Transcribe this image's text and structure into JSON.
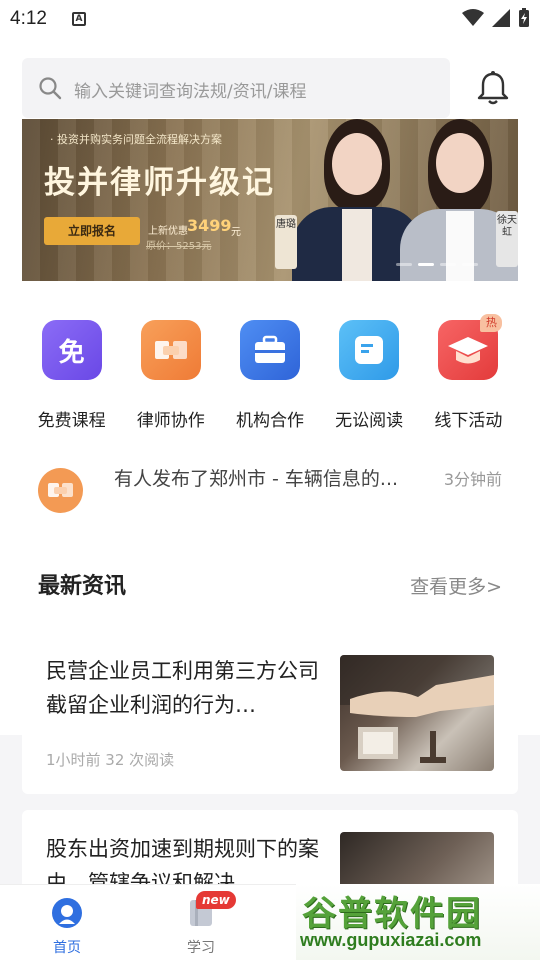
{
  "status_bar": {
    "time": "4:12",
    "sim_label": "A"
  },
  "search": {
    "placeholder": "输入关键词查询法规/资讯/课程"
  },
  "banner": {
    "subtitle": "· 投资并购实务问题全流程解决方案",
    "title": "投并律师升级记",
    "cta": "立即报名",
    "price_label": "上新优惠",
    "price": "3499",
    "price_unit": "元",
    "original_price": "原价：5253元",
    "speaker1": "唐璐",
    "speaker2": "徐天虹"
  },
  "quick_actions": [
    {
      "label": "免费课程",
      "icon": "free-course-icon",
      "color": "#7c5cf0"
    },
    {
      "label": "律师协作",
      "icon": "handshake-icon",
      "color": "#f38a45"
    },
    {
      "label": "机构合作",
      "icon": "briefcase-icon",
      "color": "#3d7bea"
    },
    {
      "label": "无讼阅读",
      "icon": "reading-icon",
      "color": "#3ba7ee"
    },
    {
      "label": "线下活动",
      "icon": "graduation-cap-icon",
      "color": "#ee4b4b",
      "badge": "热"
    }
  ],
  "notice": {
    "text": "有人发布了郑州市 - 车辆信息的...",
    "time": "3分钟前"
  },
  "news_section": {
    "title": "最新资讯",
    "more": "查看更多>"
  },
  "news": [
    {
      "title": "民营企业员工利用第三方公司截留企业利润的行为…",
      "meta": "1小时前 32 次阅读"
    },
    {
      "title": "股东出资加速到期规则下的案由、管辖争议和解决",
      "meta": ""
    }
  ],
  "tabbar": {
    "tabs": [
      {
        "label": "首页",
        "active": true
      },
      {
        "label": "学习",
        "badge": "new"
      }
    ]
  },
  "watermark": {
    "cn": "谷普软件园",
    "url": "www.gupuxiazai.com"
  }
}
